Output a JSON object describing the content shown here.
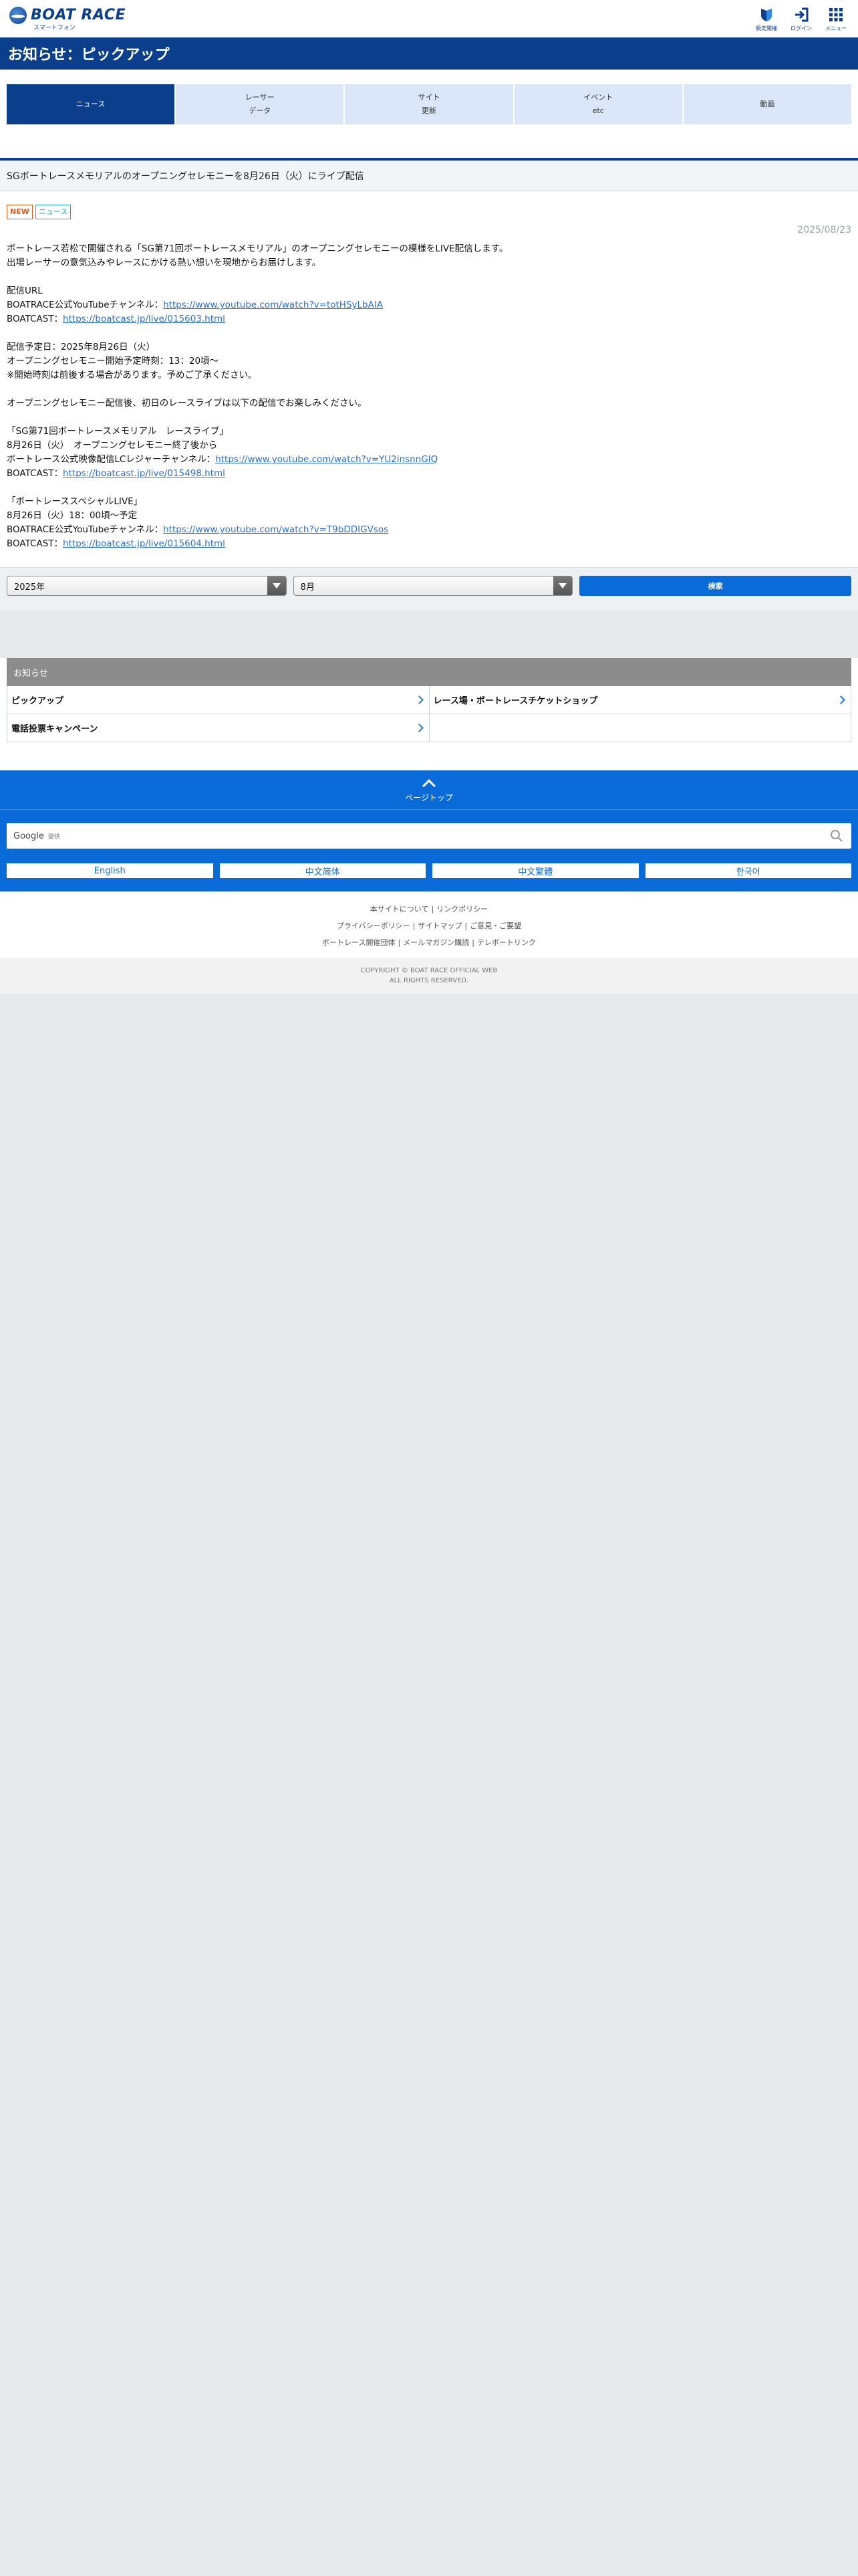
{
  "header": {
    "logo_text": "BOAT RACE",
    "logo_sub": "スマートフォン",
    "icons": [
      {
        "label": "競走開催",
        "icon": "shield-icon"
      },
      {
        "label": "ログイン",
        "icon": "login-icon"
      },
      {
        "label": "メニュー",
        "icon": "grid-menu-icon"
      }
    ]
  },
  "page_title": "お知らせ：ピックアップ",
  "tabs": [
    {
      "line1": "ニュース",
      "line2": ""
    },
    {
      "line1": "レーサー",
      "line2": "データ"
    },
    {
      "line1": "サイト",
      "line2": "更新"
    },
    {
      "line1": "イベント",
      "line2": "etc"
    },
    {
      "line1": "動画",
      "line2": ""
    }
  ],
  "article": {
    "heading": "SGボートレースメモリアルのオープニングセレモニーを8月26日（火）にライブ配信",
    "badge_new": "NEW",
    "badge_news": "ニュース",
    "date": "2025/08/23",
    "intro1": "ボートレース若松で開催される「SG第71回ボートレースメモリアル」のオープニングセレモニーの模様をLIVE配信します。",
    "intro2": "出場レーサーの意気込みやレースにかける熱い想いを現地からお届けします。",
    "url_title": "配信URL",
    "yt_label": "BOATRACE公式YouTubeチャンネル：",
    "yt_url": "https://www.youtube.com/watch?v=totHSyLbAIA",
    "bc_label1": "BOATCAST：",
    "bc_url1": "https://boatcast.jp/live/015603.html",
    "sched1": "配信予定日：2025年8月26日（火）",
    "sched2": "オープニングセレモニー開始予定時刻：13：20頃～",
    "sched3": "※開始時刻は前後する場合があります。予めご了承ください。",
    "after": "オープニングセレモニー配信後、初日のレースライブは以下の配信でお楽しみください。",
    "live_title": "「SG第71回ボートレースメモリアル　レースライブ」",
    "live_date": "8月26日（火）　オープニングセレモニー終了後から",
    "lc_label": "ボートレース公式映像配信LCレジャーチャンネル：",
    "lc_url": "https://www.youtube.com/watch?v=YU2insnnGIQ",
    "bc_label2": "BOATCAST：",
    "bc_url2": "https://boatcast.jp/live/015498.html",
    "sp_title": "「ボートレーススペシャルLIVE」",
    "sp_date": "8月26日（火）18：00頃～予定",
    "yt_label2": "BOATRACE公式YouTubeチャンネル：",
    "yt_url2": "https://www.youtube.com/watch?v=T9bDDIGVsos",
    "bc_label3": "BOATCAST：",
    "bc_url3": "https://boatcast.jp/live/015604.html"
  },
  "filter": {
    "year": "2025年",
    "month": "8月",
    "search_label": "検索"
  },
  "category": {
    "title": "お知らせ",
    "items": [
      "ピックアップ",
      "レース場・ボートレースチケットショップ",
      "電話投票キャンペーン"
    ]
  },
  "footer": {
    "pagetop": "ページトップ",
    "google": "Google",
    "google_sub": "提供",
    "langs": [
      "English",
      "中文简体",
      "中文繁體",
      "한국어"
    ],
    "links_row1": [
      "本サイトについて",
      "リンクポリシー"
    ],
    "links_row2": [
      "プライバシーポリシー",
      "サイトマップ",
      "ご意見・ご要望"
    ],
    "links_row3": [
      "ボートレース開催団体",
      "メールマガジン購読",
      "テレボートリンク"
    ],
    "copyright1": "COPYRIGHT © BOAT RACE OFFICIAL WEB",
    "copyright2": "ALL RIGHTS RESERVED."
  }
}
